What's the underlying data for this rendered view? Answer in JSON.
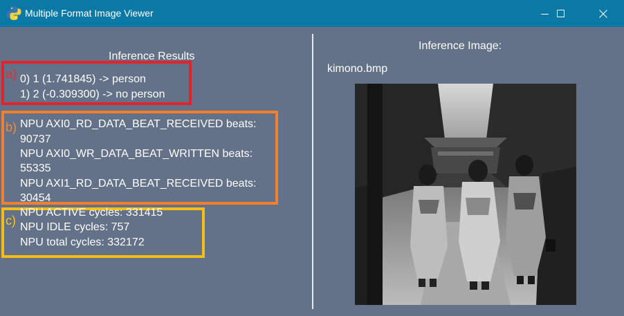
{
  "window": {
    "title": "Multiple Format Image Viewer",
    "app_icon": "python-icon",
    "controls": [
      "minimize-icon",
      "maximize-icon",
      "close-icon"
    ]
  },
  "results": {
    "heading": "Inference Results",
    "label_a": "a)",
    "label_b": "b)",
    "label_c": "c)",
    "classification": [
      "0) 1 (1.741845) -> person",
      "1) 2 (-0.309300) -> no person"
    ],
    "npu_beats": [
      "NPU AXI0_RD_DATA_BEAT_RECEIVED beats:",
      "90737",
      "NPU AXI0_WR_DATA_BEAT_WRITTEN beats:",
      "55335",
      "NPU AXI1_RD_DATA_BEAT_RECEIVED beats:",
      "30454"
    ],
    "npu_cycles": [
      "NPU ACTIVE cycles: 331415",
      "NPU IDLE cycles: 757",
      "NPU total cycles: 332172"
    ]
  },
  "inference_image": {
    "heading": "Inference Image:",
    "file_name": "kimono.bmp"
  },
  "colors": {
    "titlebar": "#0b79a6",
    "background": "#637288",
    "box_a": "#e3222b",
    "box_b": "#f47f2c",
    "box_c": "#f7bd12"
  }
}
